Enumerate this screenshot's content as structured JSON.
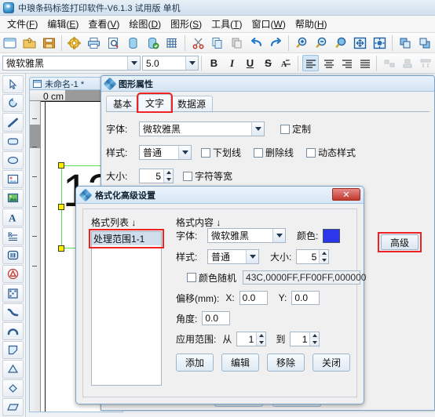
{
  "window": {
    "title": "中琅条码标签打印软件-V6.1.3 试用版 单机",
    "app_icon": "app-globe-icon"
  },
  "menubar": [
    {
      "label": "文件",
      "accel": "F"
    },
    {
      "label": "编辑",
      "accel": "E"
    },
    {
      "label": "查看",
      "accel": "V"
    },
    {
      "label": "绘图",
      "accel": "D"
    },
    {
      "label": "图形",
      "accel": "S"
    },
    {
      "label": "工具",
      "accel": "T"
    },
    {
      "label": "窗口",
      "accel": "W"
    },
    {
      "label": "帮助",
      "accel": "H"
    }
  ],
  "toolbar_main": [
    "new-document-icon",
    "open-folder-icon",
    "save-disk-icon",
    "settings-gear-icon",
    "print-icon",
    "print-preview-icon",
    "database-icon",
    "database-check-icon",
    "grid-icon",
    "cut-scissors-icon",
    "copy-icon",
    "paste-icon",
    "undo-icon",
    "redo-icon",
    "zoom-in-icon",
    "zoom-out-icon",
    "zoom-actual-icon",
    "fit-page-icon",
    "fit-width-icon",
    "align-front-icon",
    "align-back-icon"
  ],
  "toolbar_format": {
    "font_family": "微软雅黑",
    "font_size": "5.0",
    "buttons": [
      {
        "name": "bold-button",
        "label": "B"
      },
      {
        "name": "italic-button",
        "label": "I"
      },
      {
        "name": "underline-button",
        "label": "U"
      },
      {
        "name": "strikethrough-button",
        "label": "S"
      },
      {
        "name": "clear-format-button",
        "label": "A̶"
      }
    ],
    "align_buttons": [
      "align-left-icon",
      "align-center-icon",
      "align-right-icon",
      "align-justify-icon"
    ],
    "disabled_buttons": [
      "distribute-h-icon",
      "distribute-v-icon",
      "spacing-icon"
    ]
  },
  "palette": [
    "select-arrow-icon",
    "rotate-icon",
    "line-icon",
    "rounded-rect-icon",
    "ellipse-icon",
    "image-icon",
    "picture-icon",
    "text-icon",
    "rich-text-icon",
    "barcode-icon",
    "qr-warning-icon",
    "datamatrix-icon",
    "curve-icon",
    "arc-icon",
    "polygon-icon",
    "triangle-icon",
    "diamond-icon",
    "parallelogram-icon"
  ],
  "document": {
    "tab_label": "未命名-1 *",
    "ruler_label": "0 cm",
    "canvas_text": "12"
  },
  "properties": {
    "title": "图形属性",
    "tabs": [
      {
        "label": "基本",
        "active": false
      },
      {
        "label": "文字",
        "active": true,
        "highlighted": true
      },
      {
        "label": "数据源",
        "active": false
      }
    ],
    "font_label": "字体:",
    "font_value": "微软雅黑",
    "custom_label": "定制",
    "style_label": "样式:",
    "style_value": "普通",
    "underline_label": "下划线",
    "strikeout_label": "删除线",
    "dynamic_style_label": "动态样式",
    "size_label": "大小:",
    "size_value": "5",
    "monospace_label": "字符等宽",
    "advanced_button": "高级"
  },
  "dialog": {
    "title": "格式化高级设置",
    "close_label": "✕",
    "list_header": "格式列表 ↓",
    "content_header": "格式内容 ↓",
    "list_items": [
      "处理范围1-1"
    ],
    "font_label": "字体:",
    "font_value": "微软雅黑",
    "color_label": "颜色:",
    "color_value": "#2b37e8",
    "style_label": "样式:",
    "style_value": "普通",
    "size_label": "大小:",
    "size_value": "5",
    "random_color_label": "颜色随机",
    "random_color_value": "43C,0000FF,FF00FF,000000",
    "offset_label": "偏移(mm):",
    "offset_x_label": "X:",
    "offset_x_value": "0.0",
    "offset_y_label": "Y:",
    "offset_y_value": "0.0",
    "angle_label": "角度:",
    "angle_value": "0.0",
    "range_label": "应用范围:",
    "range_from_label": "从",
    "range_from_value": "1",
    "range_to_label": "到",
    "range_to_value": "1",
    "buttons": [
      {
        "name": "add-button",
        "label": "添加"
      },
      {
        "name": "edit-button",
        "label": "编辑"
      },
      {
        "name": "remove-button",
        "label": "移除"
      },
      {
        "name": "close-button",
        "label": "关闭"
      }
    ]
  },
  "colors": {
    "highlight_red": "#ee2222",
    "selection_green": "#55e055",
    "handle_yellow": "#ffee00",
    "accent_blue": "#2b37e8"
  }
}
